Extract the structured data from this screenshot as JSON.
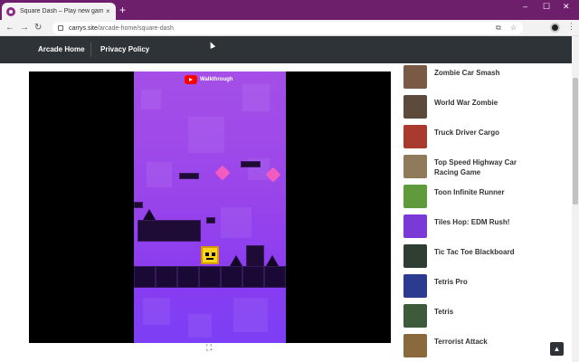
{
  "browser": {
    "tab_title": "Square Dash – Play new gam",
    "tab_close": "×",
    "new_tab": "+",
    "url_domain": "carrys.site",
    "url_path": "/arcade-home/square-dash",
    "window_controls": [
      "–",
      "☐",
      "✕"
    ]
  },
  "nav": {
    "links": [
      "Arcade Home",
      "Privacy Policy"
    ]
  },
  "game": {
    "overlay_label": "Walkthrough"
  },
  "sidebar": {
    "items": [
      {
        "label": "Zombie Car Smash",
        "thumb_color": "#7a5a44"
      },
      {
        "label": "World War Zombie",
        "thumb_color": "#5c4a3c"
      },
      {
        "label": "Truck Driver Cargo",
        "thumb_color": "#a83a2e"
      },
      {
        "label": "Top Speed Highway Car Racing Game",
        "thumb_color": "#8f7a5c"
      },
      {
        "label": "Toon Infinite Runner",
        "thumb_color": "#5f9a3c"
      },
      {
        "label": "Tiles Hop: EDM Rush!",
        "thumb_color": "#7b3ad6"
      },
      {
        "label": "Tic Tac Toe Blackboard",
        "thumb_color": "#2f3d33"
      },
      {
        "label": "Tetris Pro",
        "thumb_color": "#2b3b8f"
      },
      {
        "label": "Tetris",
        "thumb_color": "#3d5a3a"
      },
      {
        "label": "Terrorist Attack",
        "thumb_color": "#8a6a3c"
      }
    ]
  },
  "colors": {
    "tabbar": "#6d1f6b",
    "site_nav": "#2e3338",
    "accent": "#8d2b87"
  }
}
